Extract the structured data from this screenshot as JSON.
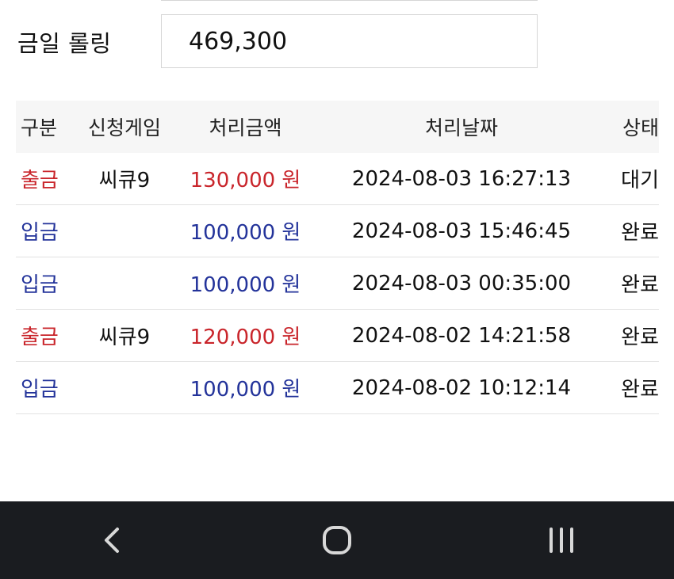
{
  "rolling": {
    "label": "금일 롤링",
    "value": "469,300"
  },
  "table": {
    "headers": [
      "구분",
      "신청게임",
      "처리금액",
      "처리날짜",
      "상태"
    ],
    "rows": [
      {
        "type": "출금",
        "game": "씨큐9",
        "amount": "130,000 원",
        "date": "2024-08-03 16:27:13",
        "status": "대기",
        "kind": "withdraw"
      },
      {
        "type": "입금",
        "game": "",
        "amount": "100,000 원",
        "date": "2024-08-03 15:46:45",
        "status": "완료",
        "kind": "deposit"
      },
      {
        "type": "입금",
        "game": "",
        "amount": "100,000 원",
        "date": "2024-08-03 00:35:00",
        "status": "완료",
        "kind": "deposit"
      },
      {
        "type": "출금",
        "game": "씨큐9",
        "amount": "120,000 원",
        "date": "2024-08-02 14:21:58",
        "status": "완료",
        "kind": "withdraw"
      },
      {
        "type": "입금",
        "game": "",
        "amount": "100,000 원",
        "date": "2024-08-02 10:12:14",
        "status": "완료",
        "kind": "deposit"
      }
    ]
  },
  "colors": {
    "withdraw": "#c9252b",
    "deposit": "#23339a",
    "navbar": "#1a1c20"
  },
  "navbar": {
    "icons": [
      "back-icon",
      "home-icon",
      "recents-icon"
    ]
  }
}
